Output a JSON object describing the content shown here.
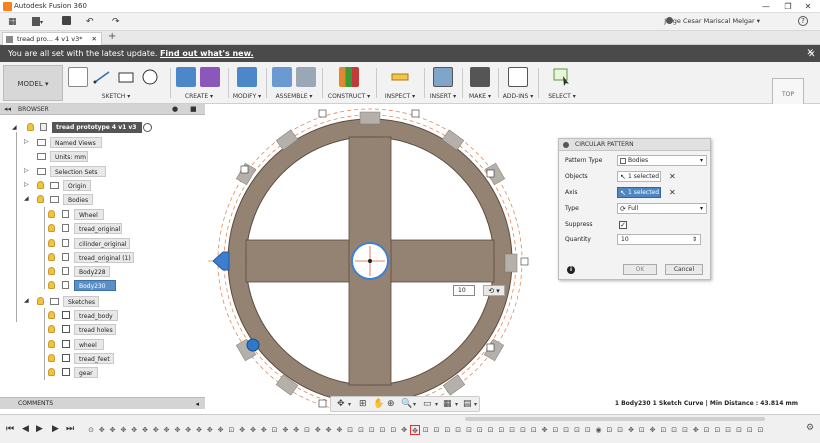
{
  "window": {
    "title": "Autodesk Fusion 360",
    "minimize": "—",
    "maximize": "❐",
    "close": "✕"
  },
  "qat": {
    "grid_icon": "▦",
    "file_icon": "▾",
    "save_icon": "💾",
    "undo_icon": "↶",
    "redo_icon": "↷",
    "user_name": "Jorge Cesar Mariscal Melgar ▾",
    "help_icon": "?"
  },
  "tabs": {
    "document_tab": "tread pro... 4 v1 v3*",
    "close": "✕",
    "add": "+"
  },
  "update_bar": {
    "message": "You are all set with the latest update.",
    "link": "Find out what's new.",
    "close": "✕"
  },
  "toolbar": {
    "model_button": "MODEL ▾",
    "groups": [
      "SKETCH ▾",
      "CREATE ▾",
      "MODIFY ▾",
      "ASSEMBLE ▾",
      "CONSTRUCT ▾",
      "INSPECT ▾",
      "INSERT ▾",
      "MAKE ▾",
      "ADD-INS ▾",
      "SELECT ▾"
    ]
  },
  "viewcube": {
    "label": "TOP",
    "close": "✕"
  },
  "browser": {
    "header": "BROWSER",
    "collapse": "◂◂",
    "ctl_pin": "●",
    "ctl_toggle": "■",
    "root": "tread prototype 4 v1 v3",
    "items": {
      "named_views": "Named Views",
      "units": "Units: mm",
      "selection_sets": "Selection Sets",
      "origin": "Origin",
      "bodies": "Bodies",
      "wheel": "Wheel",
      "tread_original": "tread_original",
      "cilinder_original": "cilinder_original",
      "tread_original_1": "tread_original (1)",
      "body228": "Body228",
      "body230": "Body230",
      "sketches": "Sketches",
      "tread_body": "tread_body",
      "tread_holes": "tread holes",
      "wheel_sketch": "wheel",
      "tread_feet": "tread_feet",
      "gear": "gear"
    }
  },
  "comments": {
    "label": "COMMENTS",
    "toggle": "◂"
  },
  "circular_pattern": {
    "title": "CIRCULAR PATTERN",
    "pattern_type_label": "Pattern Type",
    "pattern_type_value": "Bodies",
    "objects_label": "Objects",
    "objects_value": "1 selected",
    "axis_label": "Axis",
    "axis_value": "1 selected",
    "type_label": "Type",
    "type_value": "Full",
    "suppress_label": "Suppress",
    "suppress_checked": true,
    "quantity_label": "Quantity",
    "quantity_value": "10",
    "ok": "OK",
    "cancel": "Cancel",
    "info": "i",
    "remove": "✕",
    "dropdown": "▾",
    "spinner": "⇕",
    "check": "✓"
  },
  "canvas": {
    "quantity_input": "10",
    "quantity_dropdown": "⟲ ▾"
  },
  "status": {
    "text": "1 Body230 1 Sketch Curve | Min Distance : 43.814 mm"
  },
  "navbar": {
    "icons": [
      "✥",
      "▾",
      "⊞",
      "✋",
      "⊕",
      "🔍",
      "▾",
      "▭",
      "▾",
      "▦",
      "▾",
      "▤",
      "▾"
    ]
  },
  "timeline": {
    "controls": [
      "⏮",
      "◀",
      "▶",
      "▶",
      "⏭"
    ],
    "settings": "⚙",
    "items": [
      "⊙",
      "✥",
      "✥",
      "✥",
      "✥",
      "✥",
      "✥",
      "✥",
      "✥",
      "✥",
      "✥",
      "✥",
      "✥",
      "⊡",
      "✥",
      "✥",
      "✥",
      "⊡",
      "✥",
      "✥",
      "⊡",
      "✥",
      "✥",
      "✥",
      "⊡",
      "⊡",
      "⊡",
      "⊡",
      "⊡",
      "✥",
      "✥",
      "⊡",
      "⊡",
      "⊡",
      "⊡",
      "⊡",
      "⊡",
      "⊡",
      "⊡",
      "⊡",
      "⊡",
      "⊡",
      "✥",
      "⊡",
      "⊡",
      "⊡",
      "⊡",
      "◉",
      "⊡",
      "⊡",
      "✥",
      "⊡",
      "✥",
      "⊡",
      "⊡",
      "⊡",
      "✥",
      "⊡",
      "⊡",
      "⊡",
      "⊡",
      "⊡",
      "⊡"
    ],
    "highlighted_index": 30
  }
}
